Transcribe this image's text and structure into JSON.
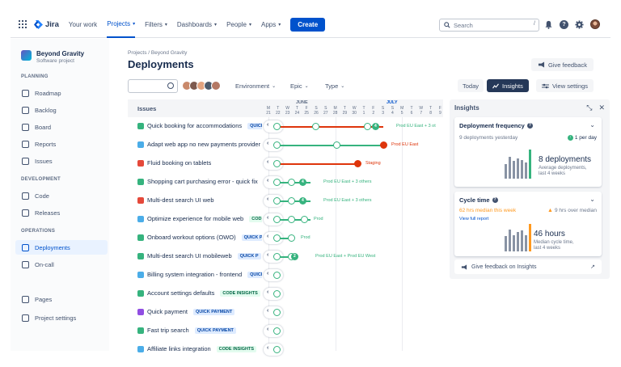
{
  "topnav": {
    "logo": "Jira",
    "items": [
      {
        "label": "Your work",
        "caret": false,
        "active": false
      },
      {
        "label": "Projects",
        "caret": true,
        "active": true
      },
      {
        "label": "Filters",
        "caret": true,
        "active": false
      },
      {
        "label": "Dashboards",
        "caret": true,
        "active": false
      },
      {
        "label": "People",
        "caret": true,
        "active": false
      },
      {
        "label": "Apps",
        "caret": true,
        "active": false
      }
    ],
    "create_label": "Create",
    "search_placeholder": "Search",
    "search_shortcut": "/"
  },
  "sidebar": {
    "project_name": "Beyond Gravity",
    "project_type": "Software project",
    "sections": [
      {
        "title": "PLANNING",
        "items": [
          "Roadmap",
          "Backlog",
          "Board",
          "Reports",
          "Issues"
        ]
      },
      {
        "title": "DEVELOPMENT",
        "items": [
          "Code",
          "Releases"
        ]
      },
      {
        "title": "OPERATIONS",
        "items": [
          "Deployments",
          "On-call"
        ]
      }
    ],
    "bottom_items": [
      "Pages",
      "Project settings"
    ],
    "active_item": "Deployments"
  },
  "header": {
    "breadcrumb": "Projects / Beyond Gravity",
    "title": "Deployments",
    "feedback_label": "Give feedback"
  },
  "filters": {
    "dropdowns": [
      "Environment",
      "Epic",
      "Type"
    ],
    "today_label": "Today",
    "insights_label": "Insights",
    "view_settings_label": "View settings"
  },
  "timeline": {
    "issues_header": "Issues",
    "months": [
      "JUNE",
      "JULY"
    ],
    "days": [
      {
        "w": "M",
        "d": "21"
      },
      {
        "w": "T",
        "d": "22"
      },
      {
        "w": "W",
        "d": "23"
      },
      {
        "w": "T",
        "d": "24"
      },
      {
        "w": "F",
        "d": "25"
      },
      {
        "w": "S",
        "d": "26"
      },
      {
        "w": "S",
        "d": "27"
      },
      {
        "w": "M",
        "d": "28"
      },
      {
        "w": "T",
        "d": "29"
      },
      {
        "w": "W",
        "d": "30"
      },
      {
        "w": "T",
        "d": "1"
      },
      {
        "w": "F",
        "d": "2"
      },
      {
        "w": "S",
        "d": "3"
      },
      {
        "w": "S",
        "d": "4"
      },
      {
        "w": "M",
        "d": "5"
      },
      {
        "w": "T",
        "d": "6"
      },
      {
        "w": "W",
        "d": "7"
      },
      {
        "w": "T",
        "d": "8"
      },
      {
        "w": "F",
        "d": "9"
      }
    ]
  },
  "issues": [
    {
      "title": "Quick booking for accommodations",
      "type": "story",
      "tag": "QUICK",
      "env": "Prod EU East + 3 ot",
      "env_color": "#36b37e",
      "pill": "4"
    },
    {
      "title": "Adapt web app no new payments provider",
      "type": "task",
      "tag": "",
      "env": "Prod EU East",
      "env_color": "#de350b",
      "pill": ""
    },
    {
      "title": "Fluid booking on tablets",
      "type": "bug",
      "tag": "",
      "env": "Staging",
      "env_color": "#de350b",
      "pill": ""
    },
    {
      "title": "Shopping cart purchasing error - quick fix",
      "type": "story",
      "tag": "",
      "env": "Prod EU East + 3 others",
      "env_color": "#36b37e",
      "pill": "4"
    },
    {
      "title": "Multi-dest search UI web",
      "type": "bug",
      "tag": "",
      "env": "Prod EU East + 3 others",
      "env_color": "#36b37e",
      "pill": "4"
    },
    {
      "title": "Optimize experience for mobile web",
      "type": "improvement",
      "tag": "COD",
      "env": "Prod",
      "env_color": "#36b37e",
      "pill": ""
    },
    {
      "title": "Onboard workout options (OWO)",
      "type": "story",
      "tag": "QUICK P",
      "env": "Prod",
      "env_color": "#36b37e",
      "pill": ""
    },
    {
      "title": "Multi-dest search UI mobileweb",
      "type": "story",
      "tag": "QUICK P",
      "env": "Prod EU East + Prod EU West",
      "env_color": "#36b37e",
      "pill": "2"
    },
    {
      "title": "Billing system integration - frontend",
      "type": "improvement",
      "tag": "QUICK",
      "env": "",
      "env_color": "#36b37e",
      "pill": ""
    },
    {
      "title": "Account settings defaults",
      "type": "story",
      "tag": "CODE INSIGHTS",
      "env": "",
      "env_color": "#36b37e",
      "pill": ""
    },
    {
      "title": "Quick payment",
      "type": "epic",
      "tag": "QUICK PAYMENT",
      "env": "",
      "env_color": "#36b37e",
      "pill": ""
    },
    {
      "title": "Fast trip search",
      "type": "story",
      "tag": "QUICK PAYMENT",
      "env": "",
      "env_color": "#36b37e",
      "pill": ""
    },
    {
      "title": "Affiliate links integration",
      "type": "task",
      "tag": "CODE INSIGHTS",
      "env": "",
      "env_color": "#36b37e",
      "pill": ""
    }
  ],
  "insights": {
    "title": "Insights",
    "deploy_freq": {
      "title": "Deployment frequency",
      "yesterday": "9 deployments yesterday",
      "delta": "1 per day",
      "big": "8 deployments",
      "caption_1": "Average deployments,",
      "caption_2": "last 4 weeks",
      "bars": [
        0.5,
        0.75,
        0.6,
        0.7,
        0.65,
        0.55,
        1.0
      ]
    },
    "cycle_time": {
      "title": "Cycle time",
      "median_week": "62 hrs median this week",
      "over_median": "9 hrs over median",
      "link": "View full report",
      "big": "46 hours",
      "caption_1": "Median cycle time,",
      "caption_2": "last 4 weeks",
      "bars": [
        0.55,
        0.8,
        0.6,
        0.7,
        0.75,
        0.6,
        1.0
      ]
    },
    "feedback": "Give feedback on Insights"
  },
  "colors": {
    "brand": "#0052cc",
    "success": "#36b37e",
    "danger": "#de350b",
    "warning": "#ff991f"
  }
}
